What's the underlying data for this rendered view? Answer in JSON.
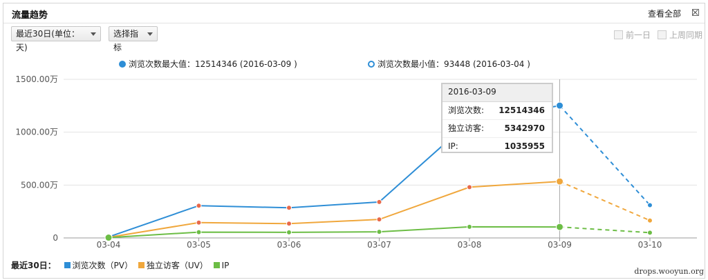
{
  "header": {
    "title": "流量趋势",
    "view_all": "查看全部"
  },
  "controls": {
    "range_dropdown": "最近30日(单位：天)",
    "metric_dropdown": "选择指标",
    "prev_day": "前一日",
    "same_period_last_week": "上周同期"
  },
  "stats": {
    "max_label": "浏览次数最大值：12514346 (2016-03-09 )",
    "min_label": "浏览次数最小值：93448 (2016-03-04 )"
  },
  "tooltip": {
    "date": "2016-03-09",
    "rows": [
      {
        "label": "浏览次数:",
        "value": "12514346"
      },
      {
        "label": "独立访客:",
        "value": "5342970"
      },
      {
        "label": "IP:",
        "value": "1035955"
      }
    ]
  },
  "legend": {
    "title": "最近30日：",
    "items": [
      "浏览次数（PV）",
      "独立访客（UV）",
      "IP"
    ]
  },
  "watermark": "drops.wooyun.org",
  "colors": {
    "pv": "#2e8ed6",
    "uv": "#f0a73c",
    "ip": "#6cbd45",
    "marker_red": "#e8694a"
  },
  "chart_data": {
    "type": "line",
    "categories": [
      "03-04",
      "03-05",
      "03-06",
      "03-07",
      "03-08",
      "03-09",
      "03-10"
    ],
    "y_ticks": [
      "0",
      "500.00万",
      "1000.00万",
      "1500.00万"
    ],
    "ylim": [
      0,
      15000000
    ],
    "highlight_index": 5,
    "dashed_from_index": 5,
    "series": [
      {
        "name": "浏览次数（PV）",
        "key": "pv",
        "values": [
          93448,
          3050000,
          2850000,
          3400000,
          11000000,
          12514346,
          3100000
        ]
      },
      {
        "name": "独立访客（UV）",
        "key": "uv",
        "values": [
          60000,
          1450000,
          1350000,
          1750000,
          4800000,
          5342970,
          1650000
        ]
      },
      {
        "name": "IP",
        "key": "ip",
        "values": [
          30000,
          550000,
          530000,
          580000,
          1050000,
          1035955,
          500000
        ]
      }
    ]
  }
}
